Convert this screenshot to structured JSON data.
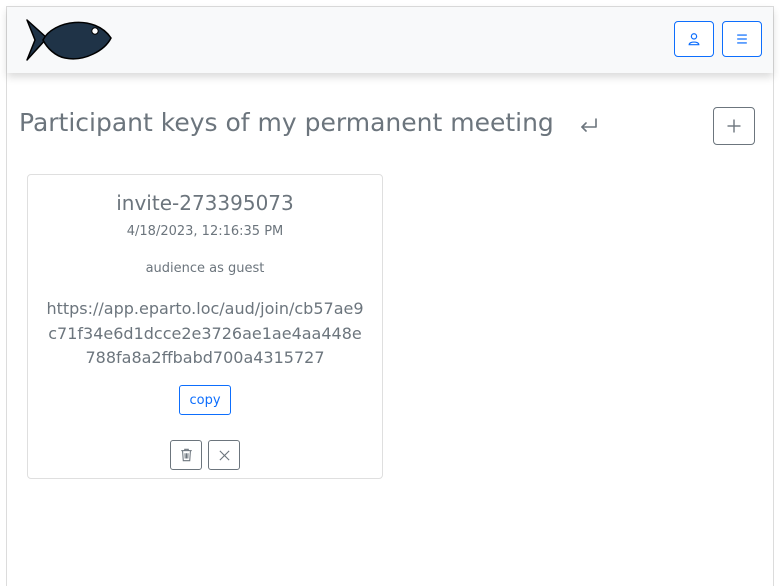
{
  "page": {
    "title": "Participant keys of my permanent meeting"
  },
  "navbar": {
    "logo_icon": "fish-logo-icon",
    "user_icon": "user-icon",
    "menu_icon": "hamburger-menu-icon"
  },
  "toolbar": {
    "back_icon": "return-arrow-icon",
    "add_icon": "plus-icon"
  },
  "keys": [
    {
      "name": "invite-273395073",
      "created": "4/18/2023, 12:16:35 PM",
      "role": "audience as guest",
      "url": "https://app.eparto.loc/aud/join/cb57ae9c71f34e6d1dcce2e3726ae1ae4aa448e788fa8a2ffbabd700a4315727",
      "copy_label": "copy",
      "delete_icon": "trash-icon",
      "close_icon": "close-icon"
    }
  ],
  "colors": {
    "primary": "#0d6efd",
    "secondary": "#6c757d",
    "navbar_bg": "#f8f9fa",
    "logo_fill": "#1f3347"
  }
}
